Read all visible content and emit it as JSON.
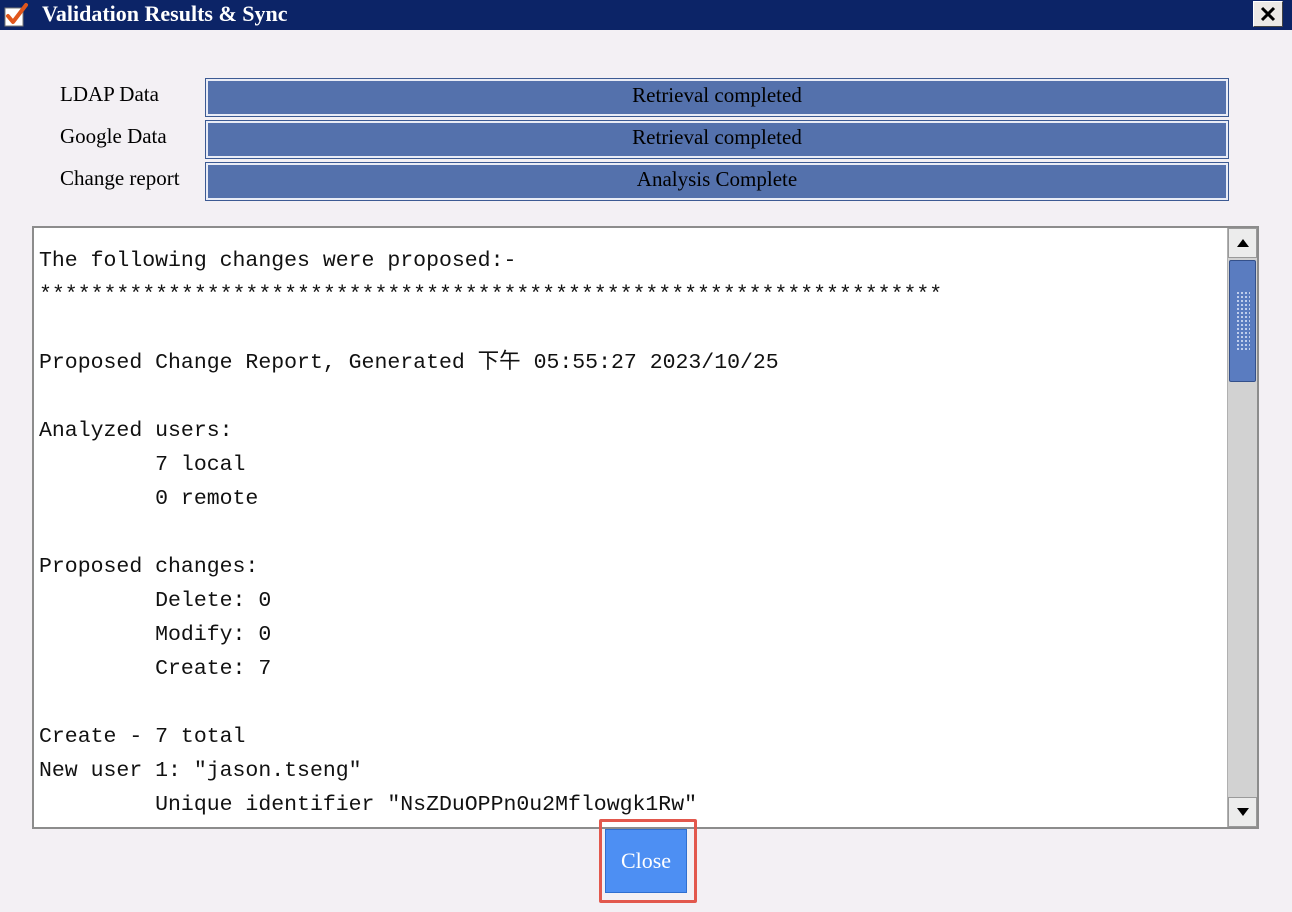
{
  "window": {
    "title": "Validation Results & Sync",
    "title_icon": "checkmark-icon",
    "close_icon": "close-icon"
  },
  "status": [
    {
      "label": "LDAP Data",
      "value": "Retrieval completed"
    },
    {
      "label": "Google Data",
      "value": "Retrieval completed"
    },
    {
      "label": "Change report",
      "value": "Analysis Complete"
    }
  ],
  "report": {
    "lines": [
      "The following changes were proposed:-",
      "**********************************************************************",
      "",
      "Proposed Change Report, Generated 下午 05:55:27 2023/10/25",
      "",
      "Analyzed users:",
      "         7 local",
      "         0 remote",
      "",
      "Proposed changes:",
      "         Delete: 0",
      "         Modify: 0",
      "         Create: 7",
      "",
      "Create - 7 total",
      "New user 1: \"jason.tseng\"",
      "         Unique identifier \"NsZDuOPPn0u2Mflowgk1Rw\""
    ]
  },
  "actions": {
    "close_label": "Close"
  },
  "colors": {
    "titlebar": "#0c2467",
    "status_bar": "#5471ac",
    "close_button": "#4d8ff3",
    "highlight": "#e2584d"
  }
}
